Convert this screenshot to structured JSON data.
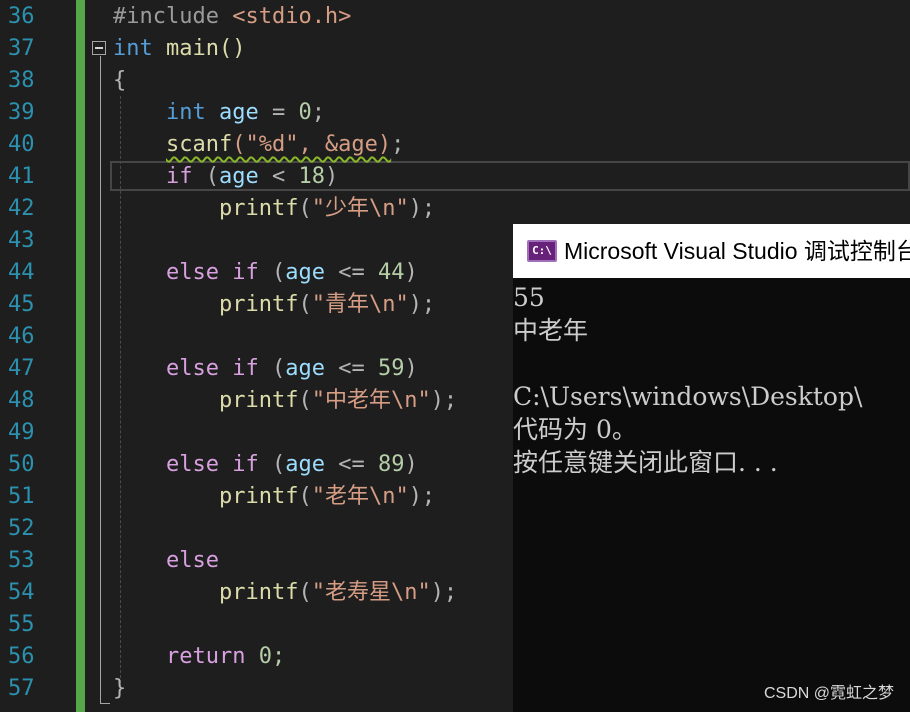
{
  "editor": {
    "line_numbers": [
      "36",
      "37",
      "38",
      "39",
      "40",
      "41",
      "42",
      "43",
      "44",
      "45",
      "46",
      "47",
      "48",
      "49",
      "50",
      "51",
      "52",
      "53",
      "54",
      "55",
      "56",
      "57"
    ],
    "tokens": {
      "include": "#include",
      "header": "<stdio.h>",
      "int_kw": "int",
      "main_fn": "main()",
      "brace_open": "{",
      "brace_close": "}",
      "age": "age",
      "assign": " = ",
      "zero": "0",
      "semi": ";",
      "scanf_fn": "scanf",
      "scanf_args": "(\"%d\", &age)",
      "if_kw": "if",
      "else_kw": "else",
      "open_paren": " (",
      "close_paren": ")",
      "lt": " < ",
      "le": " <= ",
      "n18": "18",
      "n44": "44",
      "n59": "59",
      "n89": "89",
      "printf_fn": "printf",
      "str_youth": "\"少年\\n\"",
      "str_young": "\"青年\\n\"",
      "str_middle": "\"中老年\\n\"",
      "str_old": "\"老年\\n\"",
      "str_elder": "\"老寿星\\n\"",
      "lparen": "(",
      "rparen_semi": ");",
      "return_kw": "return",
      "ret_zero": " 0;"
    }
  },
  "console": {
    "title": "Microsoft Visual Studio 调试控制台",
    "icon_label": "C:\\",
    "lines": [
      "55",
      "中老年",
      "",
      "C:\\Users\\windows\\Desktop\\",
      "代码为 0。",
      "按任意键关闭此窗口. . ."
    ]
  },
  "watermark": "CSDN @霓虹之梦",
  "colors": {
    "background": "#1e1e1e",
    "line_number": "#2b91af",
    "change_bar": "#57a64a",
    "keyword": "#569cd6",
    "control_keyword": "#d8a0df",
    "function": "#dcdcaa",
    "string": "#d69d85",
    "number": "#b5cea8",
    "variable": "#9cdcfe"
  }
}
